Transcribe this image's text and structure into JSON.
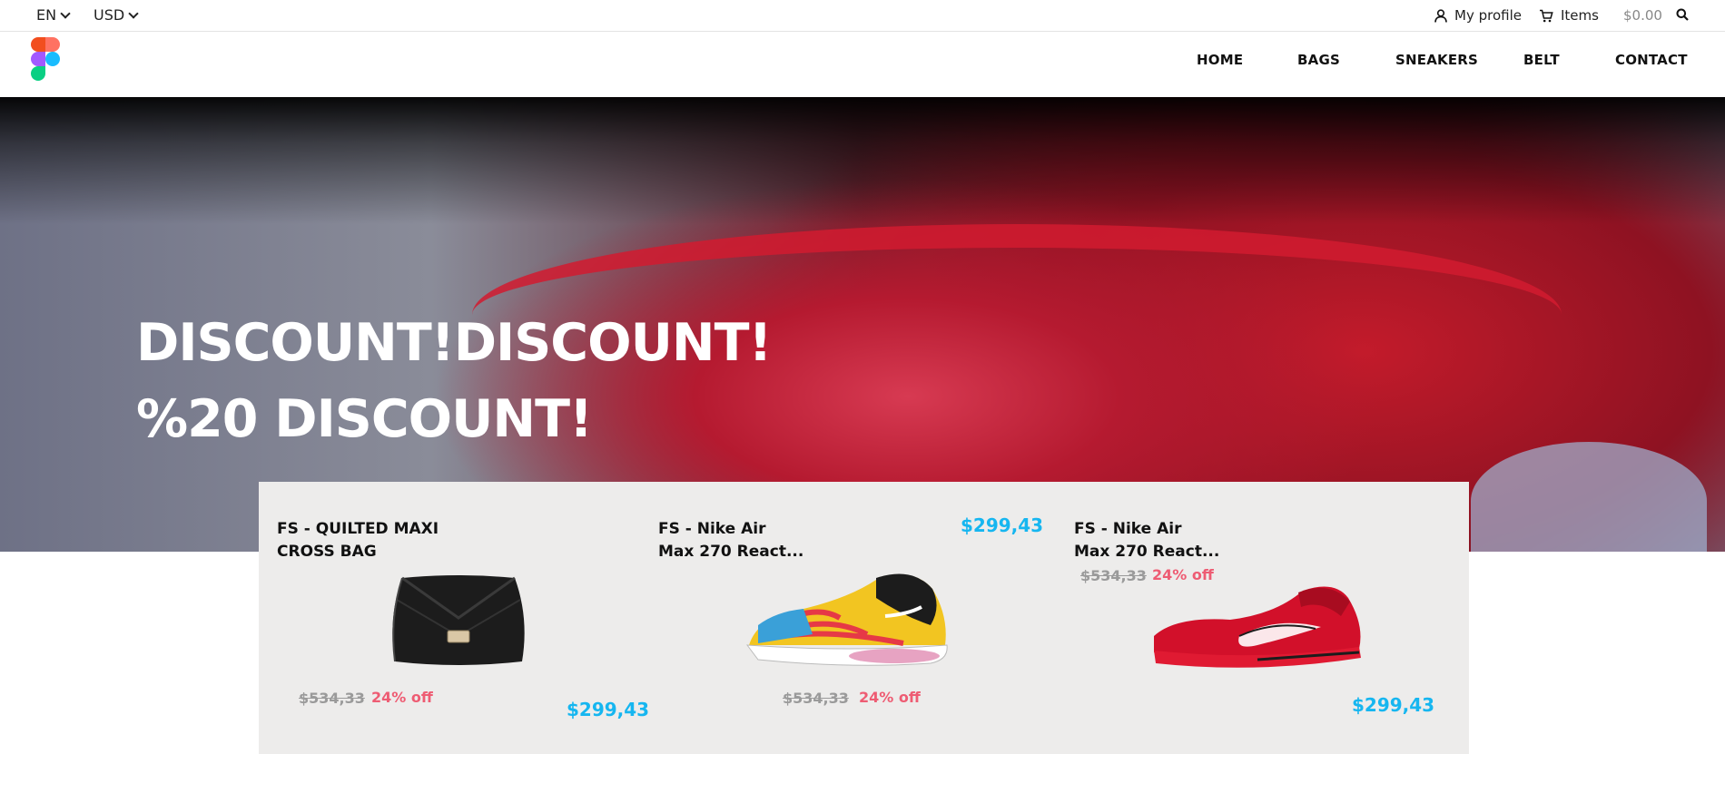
{
  "topbar": {
    "language": "EN",
    "currency": "USD",
    "profile_label": "My profile",
    "items_label": "Items",
    "cart_total": "$0.00"
  },
  "nav": {
    "home": "HOME",
    "bags": "BAGS",
    "sneakers": "SNEAKERS",
    "belt": "BELT",
    "contact": "CONTACT"
  },
  "hero": {
    "line1": "DISCOUNT!DISCOUNT!",
    "line2": "%20 DISCOUNT!"
  },
  "products": [
    {
      "title": "FS - QUILTED MAXI\nCROSS BAG",
      "old_price": "$534,33",
      "discount": "24% off",
      "price": "$299,43",
      "image_icon": "black-bag"
    },
    {
      "title": "FS - Nike Air\nMax 270 React...",
      "old_price": "$534,33",
      "discount": "24% off",
      "price": "$299,43",
      "image_icon": "multicolor-sneaker"
    },
    {
      "title": "FS - Nike Air\nMax 270 React...",
      "old_price": "$534,33",
      "discount": "24% off",
      "price": "$299,43",
      "image_icon": "red-sneaker"
    }
  ],
  "colors": {
    "price": "#16b6f0",
    "discount": "#ee5c73",
    "panel_bg": "#edeceb"
  }
}
